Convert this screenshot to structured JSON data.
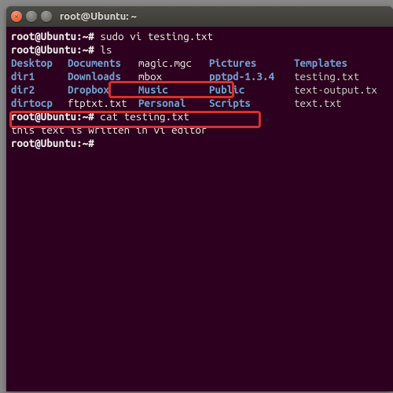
{
  "window": {
    "title": "root@Ubuntu: ~"
  },
  "prompt": "root@Ubuntu:~#",
  "commands": {
    "cmd1": "sudo vi testing.txt",
    "cmd2": "ls",
    "cmd3": "cat testing.txt",
    "cmd4": ""
  },
  "ls": {
    "row1": {
      "c1": "Desktop",
      "c2": "Documents",
      "c3": "magic.mgc",
      "c4": "Pictures",
      "c5": "Templates"
    },
    "row2": {
      "c1": "dir1",
      "c2": "Downloads",
      "c3": "mbox",
      "c4": "pptpd-1.3.4",
      "c5": "testing.txt"
    },
    "row3": {
      "c1": "dir2",
      "c2": "Dropbox",
      "c3": "Music",
      "c4": "Public",
      "c5": "text-output.tx"
    },
    "row4": {
      "c1": "dirtocp",
      "c2": "ftptxt.txt",
      "c3": "Personal",
      "c4": "Scripts",
      "c5": "text.txt"
    }
  },
  "output": {
    "blank": "",
    "line1": "this text is written in vi editor"
  },
  "icons": {
    "close": "close-icon",
    "minimize": "minimize-icon",
    "maximize": "maximize-icon"
  }
}
